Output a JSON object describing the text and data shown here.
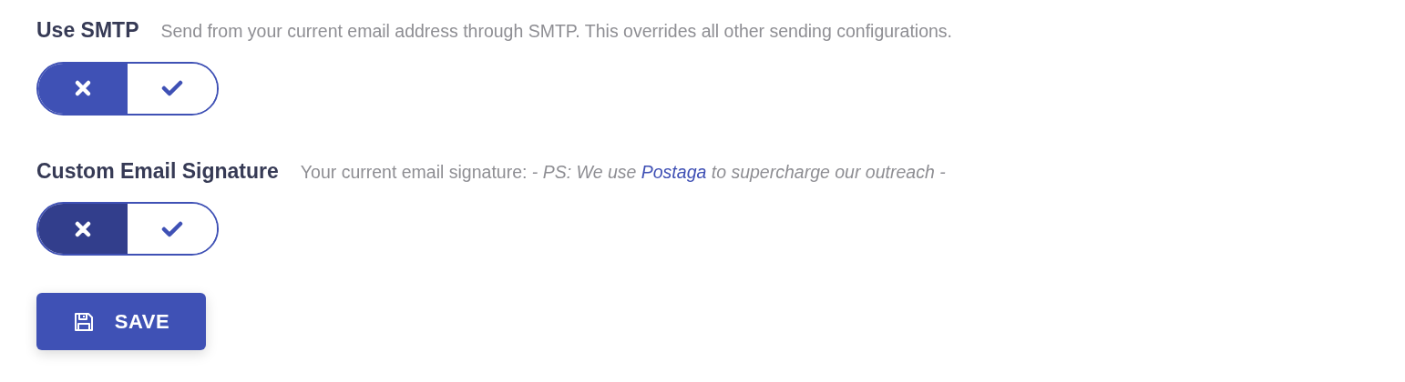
{
  "settings": [
    {
      "title": "Use SMTP",
      "description": {
        "text": "Send from your current email address through SMTP. This overrides all other sending configurations."
      },
      "enabled": false,
      "focused": false
    },
    {
      "title": "Custom Email Signature",
      "description": {
        "text": "Your current email signature:",
        "signature_before": "- PS: We use",
        "link": "Postaga",
        "signature_after": "to supercharge our outreach -"
      },
      "enabled": false,
      "focused": true
    }
  ],
  "save_button": {
    "label": "SAVE"
  }
}
